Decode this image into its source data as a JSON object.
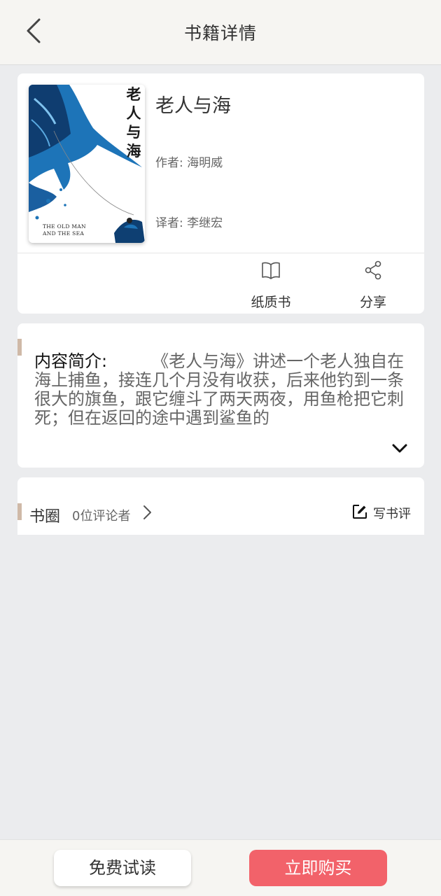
{
  "header": {
    "title": "书籍详情",
    "back_icon": "chevron-left-icon"
  },
  "book": {
    "cover_title": "老人与海",
    "cover_english": "THE OLD MAN AND THE SEA",
    "title": "老人与海",
    "author": "作者: 海明威",
    "translator": "译者: 李继宏"
  },
  "actions": {
    "paper_book": {
      "label": "纸质书",
      "icon": "open-book-icon"
    },
    "share": {
      "label": "分享",
      "icon": "share-icon"
    }
  },
  "summary": {
    "label": "内容简介:",
    "text": "《老人与海》讲述一个老人独自在海上捕鱼，接连几个月没有收获，后来他钓到一条很大的旗鱼，跟它缠斗了两天两夜，用鱼枪把它刺死；但在返回的途中遇到鲨鱼的",
    "expand_icon": "chevron-down-icon"
  },
  "book_circle": {
    "title": "书圈",
    "reviewer_count": "0位评论者",
    "write_review": "写书评",
    "write_icon": "edit-icon"
  },
  "bottom": {
    "trial_label": "免费试读",
    "buy_label": "立即购买"
  },
  "colors": {
    "accent": "#cfb9a7",
    "buy_button": "#f2626a",
    "background": "#ebecee",
    "cover_blue": "#1d74b8"
  }
}
